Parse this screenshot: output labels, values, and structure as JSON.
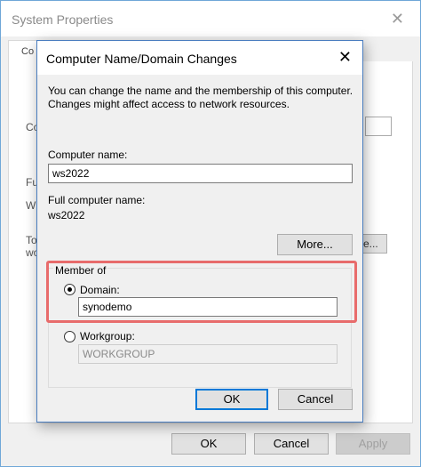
{
  "outer_window": {
    "title": "System Properties",
    "tab_fragment": "Co",
    "fragments": [
      "Co",
      "Ful",
      "W",
      "To",
      "wo"
    ],
    "partial_button": "e...",
    "buttons": {
      "ok": "OK",
      "cancel": "Cancel",
      "apply": "Apply"
    }
  },
  "dialog": {
    "title": "Computer Name/Domain Changes",
    "description": "You can change the name and the membership of this computer. Changes might affect access to network resources.",
    "computer_name_label": "Computer name:",
    "computer_name_value": "ws2022",
    "full_name_label": "Full computer name:",
    "full_name_value": "ws2022",
    "more_button": "More...",
    "member_of": {
      "label": "Member of",
      "domain_label": "Domain:",
      "domain_value": "synodemo",
      "domain_selected": true,
      "workgroup_label": "Workgroup:",
      "workgroup_value": "WORKGROUP"
    },
    "ok_button": "OK",
    "cancel_button": "Cancel",
    "highlight_color": "#e86c6c"
  }
}
